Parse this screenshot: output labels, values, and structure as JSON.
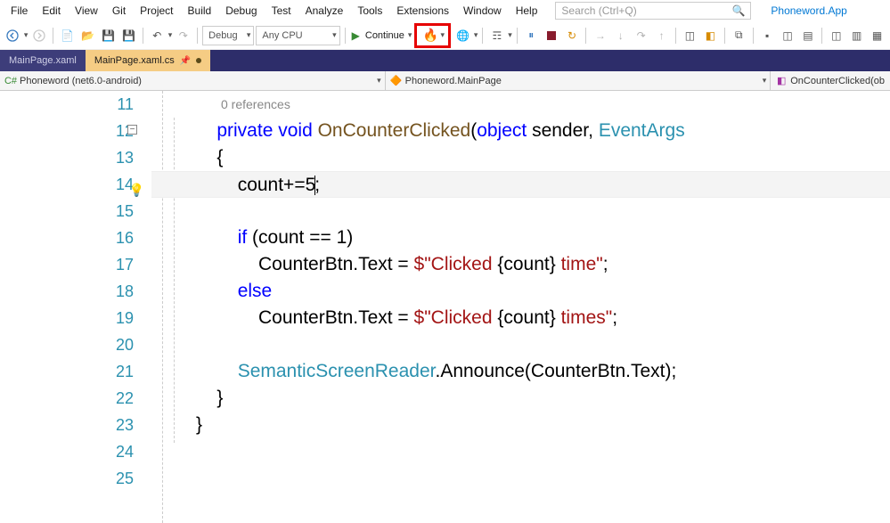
{
  "menu": [
    "File",
    "Edit",
    "View",
    "Git",
    "Project",
    "Build",
    "Debug",
    "Test",
    "Analyze",
    "Tools",
    "Extensions",
    "Window",
    "Help"
  ],
  "search": {
    "placeholder": "Search (Ctrl+Q)"
  },
  "app_label": "Phoneword.App",
  "toolbar": {
    "debug_config": "Debug",
    "platform": "Any CPU",
    "continue_label": "Continue"
  },
  "tabs": [
    {
      "title": "MainPage.xaml",
      "active": false
    },
    {
      "title": "MainPage.xaml.cs",
      "active": true
    }
  ],
  "nav": {
    "scope": "Phoneword (net6.0-android)",
    "class": "Phoneword.MainPage",
    "member": "OnCounterClicked(ob"
  },
  "code": {
    "references_label": "0 references",
    "first_line_no": 11,
    "lines": [
      "",
      "    private void OnCounterClicked(object sender, EventArgs",
      "    {",
      "        count+=5;",
      "",
      "        if (count == 1)",
      "            CounterBtn.Text = $\"Clicked {count} time\";",
      "        else",
      "            CounterBtn.Text = $\"Clicked {count} times\";",
      "",
      "        SemanticScreenReader.Announce(CounterBtn.Text);",
      "    }",
      "}",
      "",
      ""
    ],
    "tok": {
      "private": "private",
      "void": "void",
      "method": "OnCounterClicked",
      "object": "object",
      "sender": "sender",
      "eventargs": "EventArgs",
      "countinc": "count+=5",
      "if": "if",
      "cond": "(count == 1)",
      "btn": "CounterBtn",
      "text": ".Text = ",
      "str1": "$\"Clicked ",
      "interp": "{count}",
      "str2": " time\"",
      "str3": " times\"",
      "else": "else",
      "ssr": "SemanticScreenReader",
      "announce": ".Announce",
      "args": "(CounterBtn.Text);"
    }
  }
}
